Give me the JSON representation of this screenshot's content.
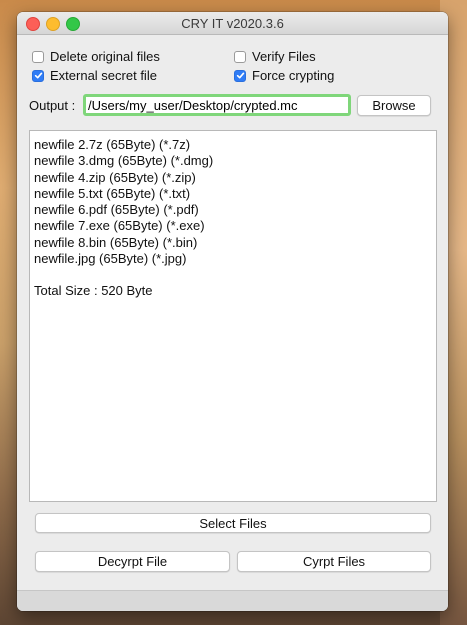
{
  "window": {
    "title": "CRY IT v2020.3.6"
  },
  "options": {
    "delete_original": {
      "label": "Delete original files",
      "checked": false
    },
    "verify_files": {
      "label": "Verify Files",
      "checked": false
    },
    "external_secret": {
      "label": "External secret file",
      "checked": true
    },
    "force_crypting": {
      "label": "Force crypting",
      "checked": true
    }
  },
  "output": {
    "label": "Output :",
    "value": "/Users/my_user/Desktop/crypted.mc",
    "browse_label": "Browse"
  },
  "files": {
    "items": [
      "newfile 2.7z (65Byte) (*.7z)",
      "newfile 3.dmg (65Byte) (*.dmg)",
      "newfile 4.zip (65Byte) (*.zip)",
      "newfile 5.txt (65Byte) (*.txt)",
      "newfile 6.pdf (65Byte) (*.pdf)",
      "newfile 7.exe (65Byte) (*.exe)",
      "newfile 8.bin (65Byte) (*.bin)",
      "newfile.jpg (65Byte) (*.jpg)"
    ],
    "total": "Total Size : 520 Byte"
  },
  "buttons": {
    "select_files": "Select Files",
    "decrypt_file": "Decyrpt File",
    "crypt_files": "Cyrpt Files"
  },
  "colors": {
    "accent": "#2f7cf6",
    "focus_ring": "#7fd67a"
  }
}
